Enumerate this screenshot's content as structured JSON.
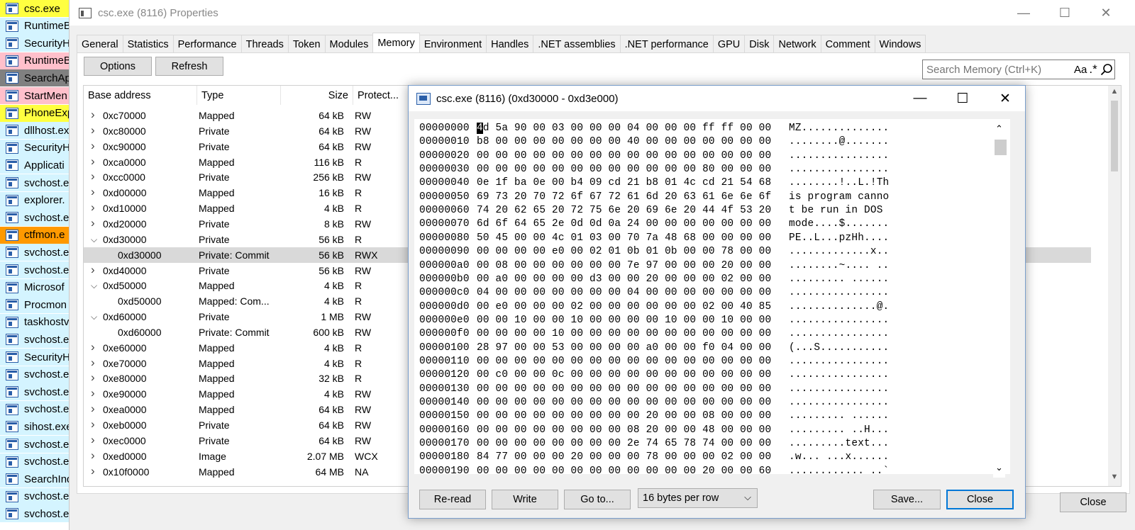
{
  "process_list": [
    {
      "name": "csc.exe",
      "color": "#ffff40"
    },
    {
      "name": "RuntimeB",
      "color": "#d4f4ff"
    },
    {
      "name": "SecurityH",
      "color": "#d4f4ff"
    },
    {
      "name": "RuntimeB",
      "color": "#ffc0cb"
    },
    {
      "name": "SearchAp",
      "color": "#808080"
    },
    {
      "name": "StartMen",
      "color": "#ffc0cb"
    },
    {
      "name": "PhoneExp",
      "color": "#ffff40"
    },
    {
      "name": "dllhost.ex",
      "color": "#d4f4ff"
    },
    {
      "name": "SecurityH",
      "color": "#d4f4ff"
    },
    {
      "name": "Applicati",
      "color": "#d4f4ff"
    },
    {
      "name": "svchost.e",
      "color": "#d4f4ff"
    },
    {
      "name": "explorer.",
      "color": "#d4f4ff"
    },
    {
      "name": "svchost.e",
      "color": "#d4f4ff"
    },
    {
      "name": "ctfmon.e",
      "color": "#ff9900"
    },
    {
      "name": "svchost.e",
      "color": "#d4f4ff"
    },
    {
      "name": "svchost.e",
      "color": "#d4f4ff"
    },
    {
      "name": "Microsof",
      "color": "#d4f4ff"
    },
    {
      "name": "Procmon",
      "color": "#d4f4ff"
    },
    {
      "name": "taskhostv",
      "color": "#d4f4ff"
    },
    {
      "name": "svchost.e",
      "color": "#d4f4ff"
    },
    {
      "name": "SecurityH",
      "color": "#d4f4ff"
    },
    {
      "name": "svchost.e",
      "color": "#d4f4ff"
    },
    {
      "name": "svchost.e",
      "color": "#d4f4ff"
    },
    {
      "name": "svchost.e",
      "color": "#d4f4ff"
    },
    {
      "name": "sihost.exe",
      "color": "#d4f4ff"
    },
    {
      "name": "svchost.e",
      "color": "#d4f4ff"
    },
    {
      "name": "svchost.e",
      "color": "#d4f4ff"
    },
    {
      "name": "SearchInd",
      "color": "#d4f4ff"
    },
    {
      "name": "svchost.e",
      "color": "#d4f4ff"
    },
    {
      "name": "svchost.e",
      "color": "#d4f4ff"
    }
  ],
  "main_window": {
    "title": "csc.exe (8116) Properties",
    "tabs": [
      "General",
      "Statistics",
      "Performance",
      "Threads",
      "Token",
      "Modules",
      "Memory",
      "Environment",
      "Handles",
      ".NET assemblies",
      ".NET performance",
      "GPU",
      "Disk",
      "Network",
      "Comment",
      "Windows"
    ],
    "active_tab": "Memory",
    "options_label": "Options",
    "refresh_label": "Refresh",
    "search_placeholder": "Search Memory (Ctrl+K)",
    "search_case_label": "Aa",
    "search_regex_label": ".*",
    "close_label": "Close",
    "columns": [
      "Base address",
      "Type",
      "Size",
      "Protect..."
    ],
    "rows": [
      {
        "expander": "collapsed",
        "address": "0xc70000",
        "type": "Mapped",
        "size": "64 kB",
        "protect": "RW"
      },
      {
        "expander": "collapsed",
        "address": "0xc80000",
        "type": "Private",
        "size": "64 kB",
        "protect": "RW"
      },
      {
        "expander": "collapsed",
        "address": "0xc90000",
        "type": "Private",
        "size": "64 kB",
        "protect": "RW"
      },
      {
        "expander": "collapsed",
        "address": "0xca0000",
        "type": "Mapped",
        "size": "116 kB",
        "protect": "R"
      },
      {
        "expander": "collapsed",
        "address": "0xcc0000",
        "type": "Private",
        "size": "256 kB",
        "protect": "RW"
      },
      {
        "expander": "collapsed",
        "address": "0xd00000",
        "type": "Mapped",
        "size": "16 kB",
        "protect": "R"
      },
      {
        "expander": "collapsed",
        "address": "0xd10000",
        "type": "Mapped",
        "size": "4 kB",
        "protect": "R"
      },
      {
        "expander": "collapsed",
        "address": "0xd20000",
        "type": "Private",
        "size": "8 kB",
        "protect": "RW"
      },
      {
        "expander": "expanded",
        "address": "0xd30000",
        "type": "Private",
        "size": "56 kB",
        "protect": "R"
      },
      {
        "expander": "child",
        "address": "0xd30000",
        "type": "Private: Commit",
        "size": "56 kB",
        "protect": "RWX",
        "selected": true
      },
      {
        "expander": "collapsed",
        "address": "0xd40000",
        "type": "Private",
        "size": "56 kB",
        "protect": "RW"
      },
      {
        "expander": "expanded",
        "address": "0xd50000",
        "type": "Mapped",
        "size": "4 kB",
        "protect": "R"
      },
      {
        "expander": "child",
        "address": "0xd50000",
        "type": "Mapped: Com...",
        "size": "4 kB",
        "protect": "R"
      },
      {
        "expander": "expanded",
        "address": "0xd60000",
        "type": "Private",
        "size": "1 MB",
        "protect": "RW"
      },
      {
        "expander": "child",
        "address": "0xd60000",
        "type": "Private: Commit",
        "size": "600 kB",
        "protect": "RW"
      },
      {
        "expander": "collapsed",
        "address": "0xe60000",
        "type": "Mapped",
        "size": "4 kB",
        "protect": "R"
      },
      {
        "expander": "collapsed",
        "address": "0xe70000",
        "type": "Mapped",
        "size": "4 kB",
        "protect": "R"
      },
      {
        "expander": "collapsed",
        "address": "0xe80000",
        "type": "Mapped",
        "size": "32 kB",
        "protect": "R"
      },
      {
        "expander": "collapsed",
        "address": "0xe90000",
        "type": "Mapped",
        "size": "4 kB",
        "protect": "RW"
      },
      {
        "expander": "collapsed",
        "address": "0xea0000",
        "type": "Mapped",
        "size": "64 kB",
        "protect": "RW"
      },
      {
        "expander": "collapsed",
        "address": "0xeb0000",
        "type": "Private",
        "size": "64 kB",
        "protect": "RW"
      },
      {
        "expander": "collapsed",
        "address": "0xec0000",
        "type": "Private",
        "size": "64 kB",
        "protect": "RW"
      },
      {
        "expander": "collapsed",
        "address": "0xed0000",
        "type": "Image",
        "size": "2.07 MB",
        "protect": "WCX"
      },
      {
        "expander": "collapsed",
        "address": "0x10f0000",
        "type": "Mapped",
        "size": "64 MB",
        "protect": "NA"
      }
    ]
  },
  "hex_window": {
    "title": "csc.exe (8116) (0xd30000 - 0xd3e000)",
    "reread_label": "Re-read",
    "write_label": "Write",
    "goto_label": "Go to...",
    "bytes_per_row": "16 bytes per row",
    "save_label": "Save...",
    "close_label": "Close",
    "lines": [
      {
        "offset": "00000000",
        "bytes": "4d 5a 90 00 03 00 00 00 04 00 00 00 ff ff 00 00",
        "ascii": "MZ.............."
      },
      {
        "offset": "00000010",
        "bytes": "b8 00 00 00 00 00 00 00 40 00 00 00 00 00 00 00",
        "ascii": "........@......."
      },
      {
        "offset": "00000020",
        "bytes": "00 00 00 00 00 00 00 00 00 00 00 00 00 00 00 00",
        "ascii": "................"
      },
      {
        "offset": "00000030",
        "bytes": "00 00 00 00 00 00 00 00 00 00 00 00 80 00 00 00",
        "ascii": "................"
      },
      {
        "offset": "00000040",
        "bytes": "0e 1f ba 0e 00 b4 09 cd 21 b8 01 4c cd 21 54 68",
        "ascii": "........!..L.!Th"
      },
      {
        "offset": "00000050",
        "bytes": "69 73 20 70 72 6f 67 72 61 6d 20 63 61 6e 6e 6f",
        "ascii": "is program canno"
      },
      {
        "offset": "00000060",
        "bytes": "74 20 62 65 20 72 75 6e 20 69 6e 20 44 4f 53 20",
        "ascii": "t be run in DOS "
      },
      {
        "offset": "00000070",
        "bytes": "6d 6f 64 65 2e 0d 0d 0a 24 00 00 00 00 00 00 00",
        "ascii": "mode....$......."
      },
      {
        "offset": "00000080",
        "bytes": "50 45 00 00 4c 01 03 00 70 7a 48 68 00 00 00 00",
        "ascii": "PE..L...pzHh...."
      },
      {
        "offset": "00000090",
        "bytes": "00 00 00 00 e0 00 02 01 0b 01 0b 00 00 78 00 00",
        "ascii": ".............x.."
      },
      {
        "offset": "000000a0",
        "bytes": "00 08 00 00 00 00 00 00 7e 97 00 00 00 20 00 00",
        "ascii": "........~.... .."
      },
      {
        "offset": "000000b0",
        "bytes": "00 a0 00 00 00 00 d3 00 00 20 00 00 00 02 00 00",
        "ascii": "......... ......"
      },
      {
        "offset": "000000c0",
        "bytes": "04 00 00 00 00 00 00 00 04 00 00 00 00 00 00 00",
        "ascii": "................"
      },
      {
        "offset": "000000d0",
        "bytes": "00 e0 00 00 00 02 00 00 00 00 00 00 02 00 40 85",
        "ascii": "..............@."
      },
      {
        "offset": "000000e0",
        "bytes": "00 00 10 00 00 10 00 00 00 00 10 00 00 10 00 00",
        "ascii": "................"
      },
      {
        "offset": "000000f0",
        "bytes": "00 00 00 00 10 00 00 00 00 00 00 00 00 00 00 00",
        "ascii": "................"
      },
      {
        "offset": "00000100",
        "bytes": "28 97 00 00 53 00 00 00 00 a0 00 00 f0 04 00 00",
        "ascii": "(...S..........."
      },
      {
        "offset": "00000110",
        "bytes": "00 00 00 00 00 00 00 00 00 00 00 00 00 00 00 00",
        "ascii": "................"
      },
      {
        "offset": "00000120",
        "bytes": "00 c0 00 00 0c 00 00 00 00 00 00 00 00 00 00 00",
        "ascii": "................"
      },
      {
        "offset": "00000130",
        "bytes": "00 00 00 00 00 00 00 00 00 00 00 00 00 00 00 00",
        "ascii": "................"
      },
      {
        "offset": "00000140",
        "bytes": "00 00 00 00 00 00 00 00 00 00 00 00 00 00 00 00",
        "ascii": "................"
      },
      {
        "offset": "00000150",
        "bytes": "00 00 00 00 00 00 00 00 00 20 00 00 08 00 00 00",
        "ascii": "......... ......"
      },
      {
        "offset": "00000160",
        "bytes": "00 00 00 00 00 00 00 00 08 20 00 00 48 00 00 00",
        "ascii": "......... ..H..."
      },
      {
        "offset": "00000170",
        "bytes": "00 00 00 00 00 00 00 00 2e 74 65 78 74 00 00 00",
        "ascii": ".........text..."
      },
      {
        "offset": "00000180",
        "bytes": "84 77 00 00 00 20 00 00 00 78 00 00 00 02 00 00",
        "ascii": ".w... ...x......"
      },
      {
        "offset": "00000190",
        "bytes": "00 00 00 00 00 00 00 00 00 00 00 00 20 00 00 60",
        "ascii": "............ ..`"
      }
    ]
  }
}
